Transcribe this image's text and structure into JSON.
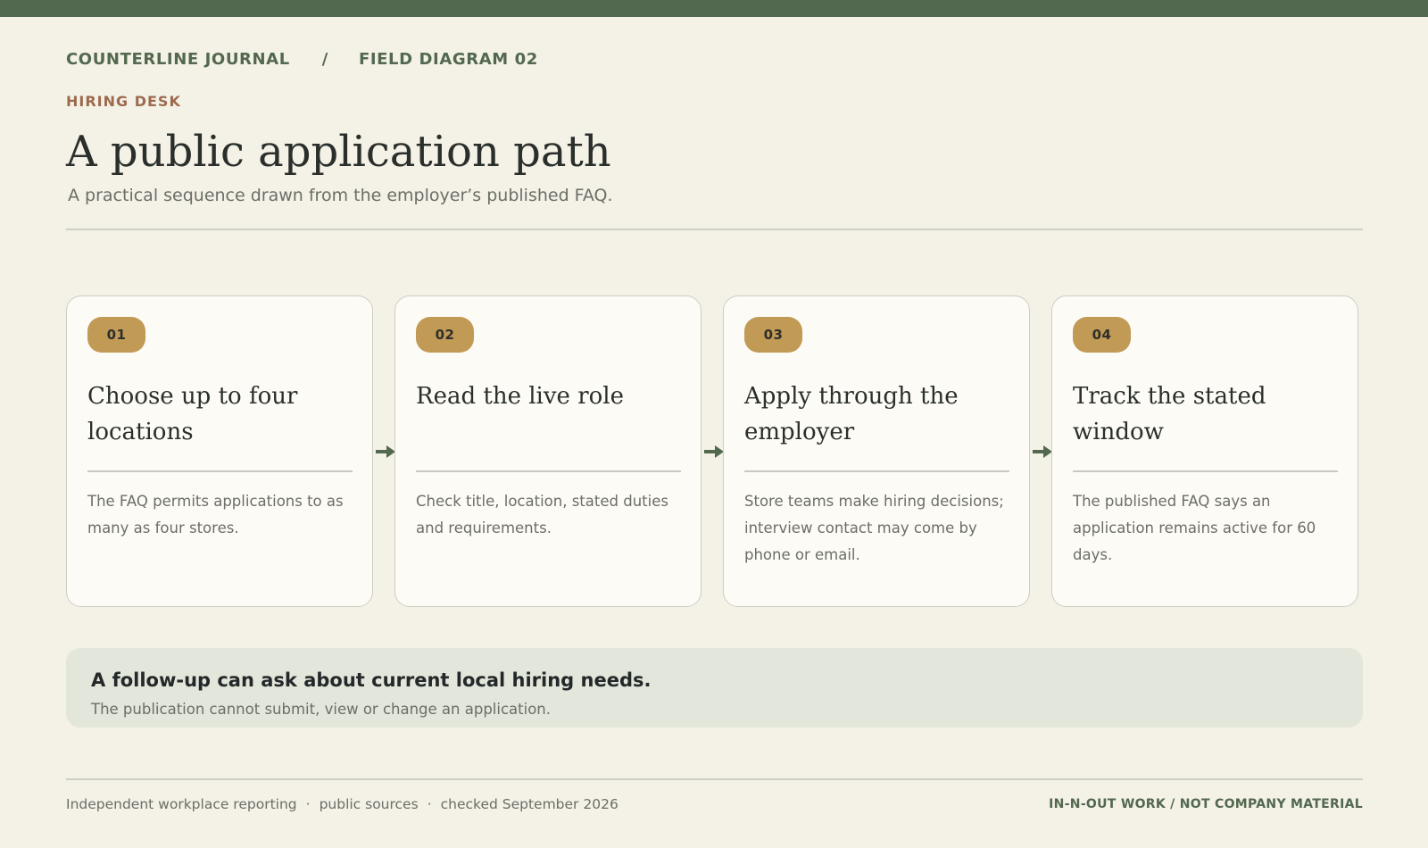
{
  "header": {
    "publication": "COUNTERLINE JOURNAL",
    "separator": "/",
    "section": "FIELD DIAGRAM 02",
    "kicker": "HIRING DESK",
    "title": "A public application path",
    "subtitle": "A practical sequence drawn from the employer’s published FAQ."
  },
  "steps": [
    {
      "number": "01",
      "title": "Choose up to four locations",
      "description": "The FAQ permits applications to as many as four stores."
    },
    {
      "number": "02",
      "title": "Read the live role",
      "description": "Check title, location, stated duties and requirements."
    },
    {
      "number": "03",
      "title": "Apply through the employer",
      "description": "Store teams make hiring decisions; interview contact may come by phone or email."
    },
    {
      "number": "04",
      "title": "Track the stated window",
      "description": "The published FAQ says an application remains active for 60 days."
    }
  ],
  "note": {
    "headline": "A follow-up can ask about current local hiring needs.",
    "subtext": "The publication cannot submit, view or change an application."
  },
  "footer": {
    "left_items": [
      "Independent workplace reporting",
      "public sources",
      "checked September 2026"
    ],
    "left_separator": "·",
    "right": "IN-N-OUT WORK / NOT COMPANY MATERIAL"
  },
  "colors": {
    "background": "#f4f1e7",
    "brand_green": "#52684f",
    "kicker_rust": "#9c6b4e",
    "badge_gold": "#c19a56",
    "card_bg": "#fdfbf5",
    "note_bg": "#e3e6da"
  },
  "icons": {
    "connector": "arrow-right-icon"
  }
}
